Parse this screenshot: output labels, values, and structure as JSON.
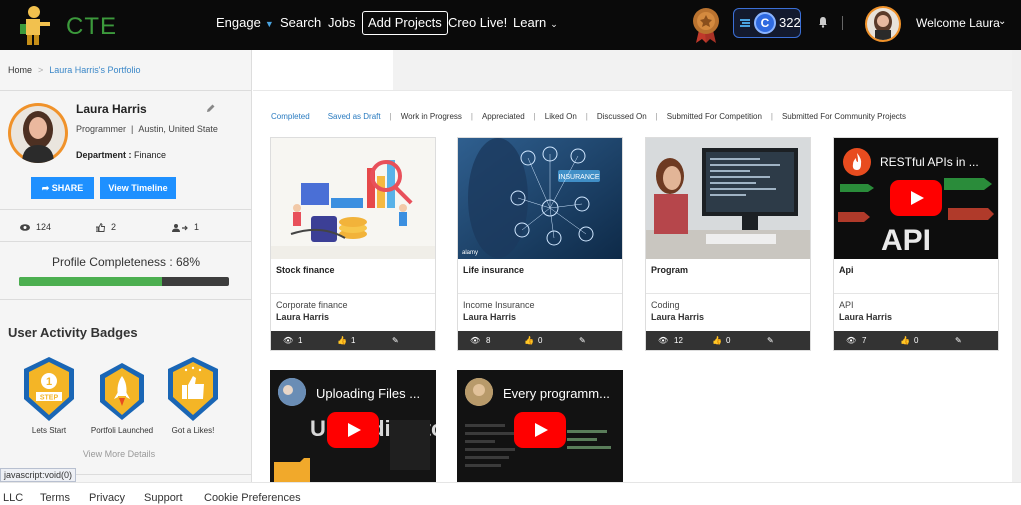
{
  "header": {
    "logo_text": "CTE",
    "nav": [
      {
        "label": "Engage",
        "has_chevron": true
      },
      {
        "label": "Search"
      },
      {
        "label": "Jobs"
      },
      {
        "label": "Add Projects",
        "boxed": true
      },
      {
        "label": "Creo Live!"
      },
      {
        "label": "Learn",
        "has_chevron": true
      }
    ],
    "coins": "322",
    "coin_letter": "C",
    "welcome": "Welcome Laura"
  },
  "breadcrumb": {
    "home": "Home",
    "current": "Laura Harris's Portfolio"
  },
  "profile": {
    "name": "Laura Harris",
    "role": "Programmer",
    "location": "Austin, United State",
    "department_label": "Department :",
    "department": "Finance",
    "share_label": "SHARE",
    "timeline_label": "View Timeline",
    "views": "124",
    "likes": "2",
    "follows": "1",
    "completeness_label": "Profile Completeness : 68%",
    "completeness": 0.68
  },
  "badges": {
    "title": "User Activity Badges",
    "items": [
      {
        "label": "Lets Start",
        "icon_text": "1",
        "icon_sub": "STEP"
      },
      {
        "label": "Portfoli Launched"
      },
      {
        "label": "Got a Likes!"
      }
    ],
    "view_more": "View More Details"
  },
  "status_url": "javascript:void(0)",
  "tabs": [
    {
      "label": "Completed",
      "active": true
    },
    {
      "label": "Saved as Draft",
      "active": true
    },
    {
      "label": "Work in Progress"
    },
    {
      "label": "Appreciated"
    },
    {
      "label": "Liked On"
    },
    {
      "label": "Discussed On"
    },
    {
      "label": "Submitted For Competition"
    },
    {
      "label": "Submitted For Community Projects"
    }
  ],
  "projects": [
    {
      "title": "Stock finance",
      "category": "Corporate finance",
      "author": "Laura Harris",
      "views": "1",
      "likes": "1"
    },
    {
      "title": "Life insurance",
      "category": "Income Insurance",
      "author": "Laura Harris",
      "views": "8",
      "likes": "0",
      "thumb_text": "INSURANCE",
      "watermark": "alamy"
    },
    {
      "title": "Program",
      "category": "Coding",
      "author": "Laura Harris",
      "views": "12",
      "likes": "0"
    },
    {
      "title": "Api",
      "category": "API",
      "author": "Laura Harris",
      "views": "7",
      "likes": "0",
      "video_title": "RESTful APIs in ...",
      "big_text": "API"
    }
  ],
  "videos": [
    {
      "title": "Uploading Files ...",
      "overlay": "Uploading to GitHub"
    },
    {
      "title": "Every programm..."
    }
  ],
  "footer": [
    "LLC",
    "Terms",
    "Privacy",
    "Support",
    "Cookie Preferences"
  ],
  "colors": {
    "accent": "#1e90ff",
    "orange": "#f0922a",
    "green": "#4caf50",
    "link": "#2a7bc0"
  }
}
